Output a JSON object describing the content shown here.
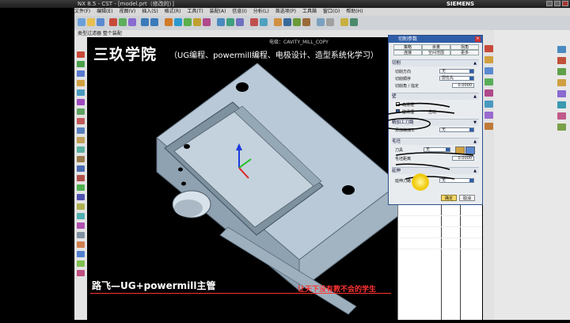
{
  "window": {
    "title": "NX 8.5 - CST - [model.prt（修改的）]",
    "brand": "SIEMENS"
  },
  "menu": {
    "items": [
      "文件(F)",
      "编辑(E)",
      "视图(V)",
      "插入(S)",
      "格式(R)",
      "工具(T)",
      "装配(A)",
      "信息(I)",
      "分析(L)",
      "首选项(P)",
      "工具箱",
      "窗口(O)",
      "帮助(H)"
    ]
  },
  "toolbar2": {
    "label": "类型过滤器  整个装配"
  },
  "viewport": {
    "header": "电极：CAVITY_MILL_COPY"
  },
  "overlay": {
    "title": "三玖学院",
    "subtitle": "（UG编程、powermill编程、电极设计、造型系统化学习）",
    "bottom_left": "路飞—UG+powermill主管",
    "bottom_right": "让天下没有教不会的学生"
  },
  "dialog": {
    "title": "切削参数",
    "close": "×",
    "tabs_row1": [
      "策略",
      "余量",
      "拐角"
    ],
    "tabs_row2": [
      "连接",
      "空间范围",
      "更多"
    ],
    "section_cut": "切削",
    "cut_direction_label": "切削方向",
    "cut_direction_value": "无",
    "cut_order_label": "切削顺序",
    "cut_order_value": "层优先",
    "cut_angle_label": "切削角 / 指定",
    "cut_angle_value": "0.0000",
    "section_wall": "壁",
    "wall_check1": "岛清根",
    "wall_check2": "壁清理",
    "wall_clean_label": "自动",
    "section_finish": "精加工刀路",
    "finish_label": "添加精加工",
    "finish_value": "无",
    "section_blank": "毛坯",
    "blank_label": "毛坯距离",
    "blank_value": "0.0000",
    "blank_tool_label": "刀具",
    "blank_tool_value": "无",
    "section_extra": "延伸",
    "extra_label": "延伸刀路",
    "extra_value": "无",
    "ok": "确定",
    "cancel": "取消"
  },
  "colors": {
    "dialog_title_bg": "#2f5ea8",
    "model_fill": "#b8c8d6",
    "accent_red": "#ff3333",
    "highlight": "#f0c800"
  }
}
